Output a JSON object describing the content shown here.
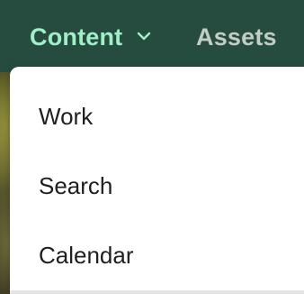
{
  "nav": {
    "tabs": [
      {
        "label": "Content",
        "active": true,
        "icon": "chevron-down-icon"
      },
      {
        "label": "Assets",
        "active": false
      }
    ]
  },
  "dropdown": {
    "items": [
      {
        "label": "Work"
      },
      {
        "label": "Search"
      },
      {
        "label": "Calendar"
      }
    ]
  },
  "colors": {
    "topbar_bg": "#254c3e",
    "active_tab": "#9ff0c8",
    "inactive_tab": "#c4ccc6",
    "menu_bg": "#ffffff",
    "menu_text": "#1f1f1f"
  }
}
